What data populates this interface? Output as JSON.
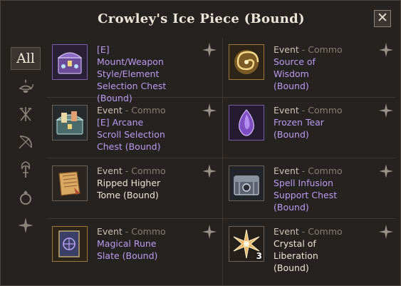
{
  "window": {
    "title": "Crowley's Ice Piece (Bound)",
    "close_glyph": "✕"
  },
  "sidebar": {
    "tabs": [
      {
        "label": "All",
        "icon": "all-tab",
        "active": true
      },
      {
        "icon": "lamp-icon"
      },
      {
        "icon": "crossed-axes-icon"
      },
      {
        "icon": "bow-icon"
      },
      {
        "icon": "staff-icon"
      },
      {
        "icon": "ring-icon"
      },
      {
        "icon": "sparkle-icon"
      }
    ]
  },
  "items": [
    {
      "source": "",
      "name": "[E] Mount/Weapon Style/Element Selection Chest (Bound)",
      "name_color": "purple",
      "icon": "purple-chest-icon"
    },
    {
      "source": "Event",
      "source_extra": "Commo",
      "name": "Source of Wisdom (Bound)",
      "name_color": "purple",
      "icon": "golden-spiral-icon"
    },
    {
      "source": "Event",
      "source_extra": "Commo",
      "name": "[E] Arcane Scroll Selection Chest (Bound)",
      "name_color": "purple",
      "icon": "scroll-chest-icon"
    },
    {
      "source": "Event",
      "source_extra": "Commo",
      "name": "Frozen Tear (Bound)",
      "name_color": "purple",
      "icon": "purple-gem-icon"
    },
    {
      "source": "Event",
      "source_extra": "Commo",
      "name": "Ripped Higher Tome (Bound)",
      "name_color": "white",
      "icon": "torn-tome-icon"
    },
    {
      "source": "Event",
      "source_extra": "Commo",
      "name": "Spell Infusion Support Chest (Bound)",
      "name_color": "purple",
      "icon": "silver-chest-icon"
    },
    {
      "source": "Event",
      "source_extra": "Commo",
      "name": "Magical Rune Slate (Bound)",
      "name_color": "purple",
      "icon": "rune-slate-icon"
    },
    {
      "source": "Event",
      "source_extra": "Commo",
      "name": "Crystal of Liberation (Bound)",
      "name_color": "white",
      "icon": "crystal-star-icon",
      "quantity": "3"
    }
  ]
}
